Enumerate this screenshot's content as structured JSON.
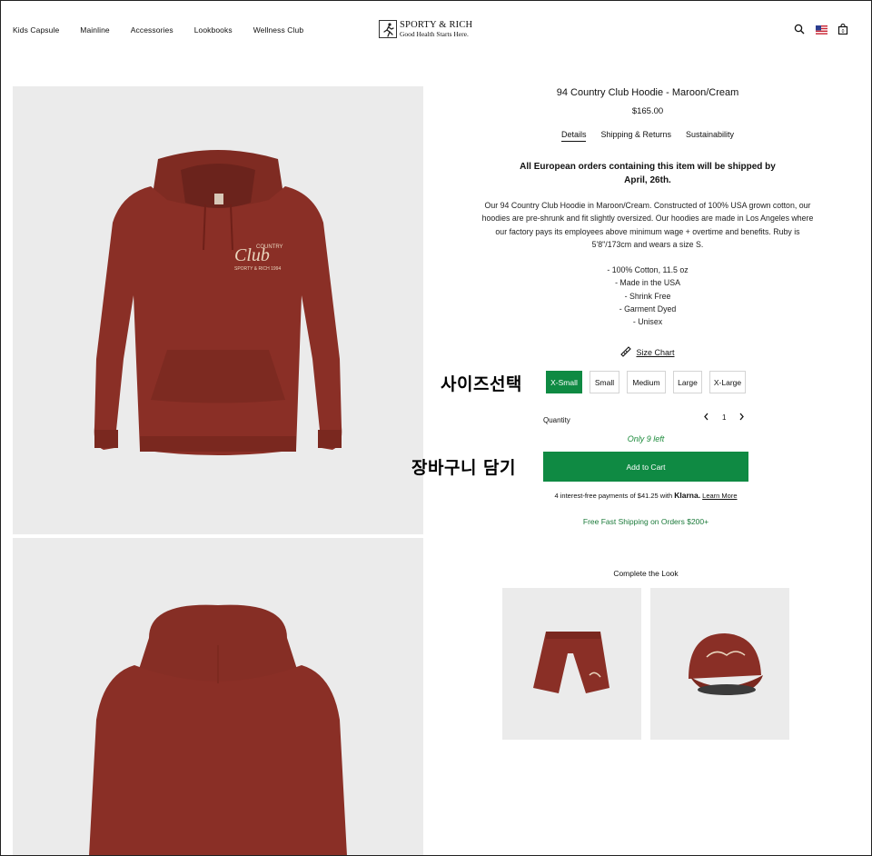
{
  "header": {
    "nav": [
      "Kids Capsule",
      "Mainline",
      "Accessories",
      "Lookbooks",
      "Wellness Club"
    ],
    "logo_line1": "SPORTY & RICH",
    "logo_line2": "Good Health Starts Here.",
    "icons": [
      "search-icon",
      "us-flag-icon",
      "cart-icon"
    ],
    "cart_count": "0"
  },
  "product": {
    "title": "94 Country Club Hoodie - Maroon/Cream",
    "price": "$165.00",
    "tabs": [
      "Details",
      "Shipping & Returns",
      "Sustainability"
    ],
    "active_tab": "Details",
    "notice_line1": "All European orders containing this item will be shipped by",
    "notice_line2": "April, 26th.",
    "description": "Our 94 Country Club Hoodie in Maroon/Cream. Constructed of 100% USA grown cotton, our hoodies are pre-shrunk and fit slightly oversized. Our hoodies are made in Los Angeles where our factory pays its employees above minimum wage + overtime and benefits. Ruby is 5'8\"/173cm and wears a size S.",
    "bullets": [
      "- 100% Cotton, 11.5 oz",
      "- Made in the USA",
      "- Shrink Free",
      "- Garment Dyed",
      "- Unisex"
    ],
    "size_chart_label": "Size Chart",
    "sizes": [
      "X-Small",
      "Small",
      "Medium",
      "Large",
      "X-Large"
    ],
    "selected_size": "X-Small",
    "quantity_label": "Quantity",
    "quantity_value": "1",
    "stock_text": "Only 9 left",
    "add_to_cart_label": "Add to Cart",
    "klarna_prefix": "4 interest-free payments of $41.25 with",
    "klarna_brand": "Klarna.",
    "klarna_link": "Learn More",
    "free_shipping": "Free Fast Shipping on Orders $200+",
    "complete_look_title": "Complete the Look",
    "print_word_top": "COUNTRY",
    "print_word_main": "Club",
    "print_word_bottom": "SPORTY & RICH   1994"
  },
  "annotations": {
    "size_select": "사이즈선택",
    "add_to_cart": "장바구니 담기"
  },
  "colors": {
    "accent_green": "#0f8a43",
    "garment_maroon": "#8a2f26",
    "image_background": "#ebebeb"
  }
}
